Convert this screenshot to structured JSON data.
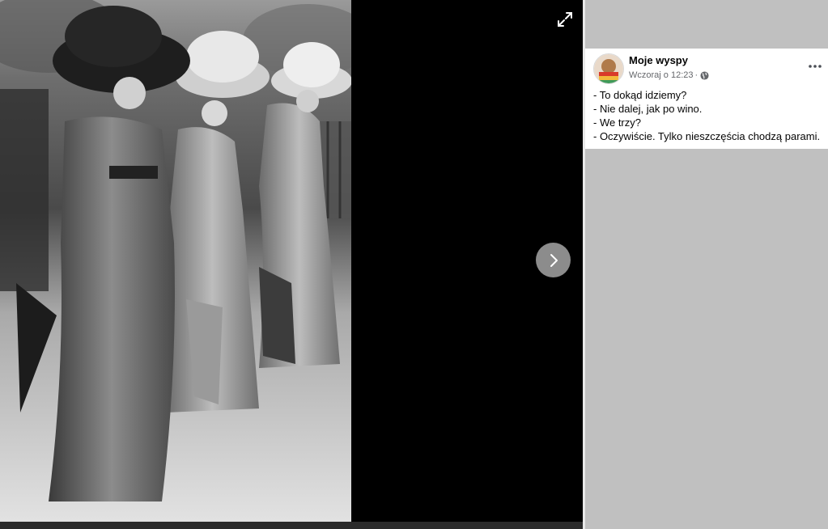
{
  "viewer": {
    "photo_icon": "photo-image",
    "expand_icon": "expand-icon",
    "next_icon": "chevron-right-icon"
  },
  "post": {
    "author": "Moje wyspy",
    "timestamp": "Wczoraj o 12:23",
    "separator": "·",
    "privacy_icon": "globe-icon",
    "more_icon": "more-dots-icon",
    "lines": [
      "- To dokąd idziemy?",
      "- Nie dalej, jak po wino.",
      "- We trzy?",
      "- Oczywiście. Tylko nieszczęścia chodzą parami."
    ]
  },
  "colors": {
    "sidebar_bg": "#c0c0c0",
    "card_bg": "#ffffff",
    "text": "#050505",
    "meta": "#65676b",
    "viewer_bg": "#000000",
    "nav_button": "#8c8c8c"
  }
}
